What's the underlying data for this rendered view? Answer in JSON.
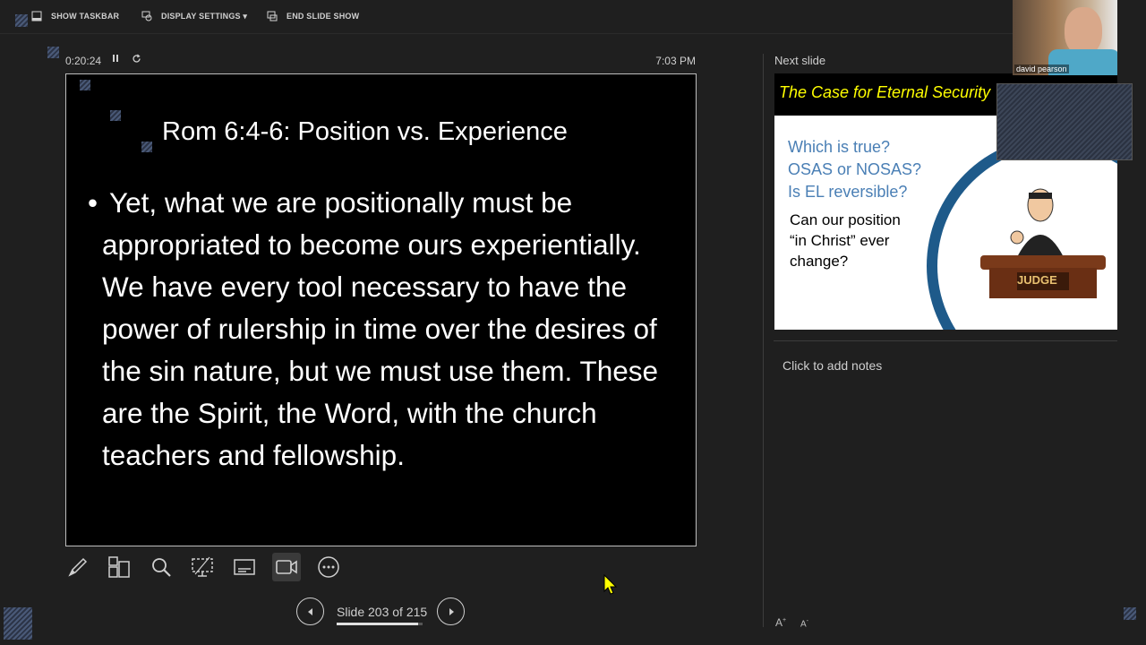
{
  "toolbar": {
    "show_taskbar": "SHOW TASKBAR",
    "display_settings": "DISPLAY SETTINGS",
    "end_slide_show": "END SLIDE SHOW"
  },
  "timer": {
    "elapsed": "0:20:24",
    "clock": "7:03 PM"
  },
  "current_slide": {
    "title": "Rom 6:4-6: Position vs. Experience",
    "bullet": "•",
    "body": "Yet, what we are positionally must be appropriated to become ours experientially. We have every tool necessary to have the power of rulership in time over the desires of the sin nature, but we must use them. These are the Spirit, the Word, with the church teachers and fellowship."
  },
  "navigation": {
    "slide_counter": "Slide 203 of 215",
    "current": 203,
    "total": 215
  },
  "next_slide": {
    "label": "Next slide",
    "title": "The Case for Eternal Security",
    "questions": [
      "Which is true?",
      "OSAS or NOSAS?",
      "Is EL reversible?"
    ],
    "body": [
      "Can our position",
      "“in Christ” ever",
      "change?"
    ],
    "judge_label": "JUDGE"
  },
  "notes": {
    "placeholder": "Click to add notes"
  },
  "webcam": {
    "name": "david pearson"
  },
  "font_controls": {
    "increase": "A",
    "decrease": "A"
  },
  "colors": {
    "background": "#1f1f1f",
    "slide_bg": "#000000",
    "next_title": "#ffff00",
    "next_question": "#4a7fb5"
  }
}
